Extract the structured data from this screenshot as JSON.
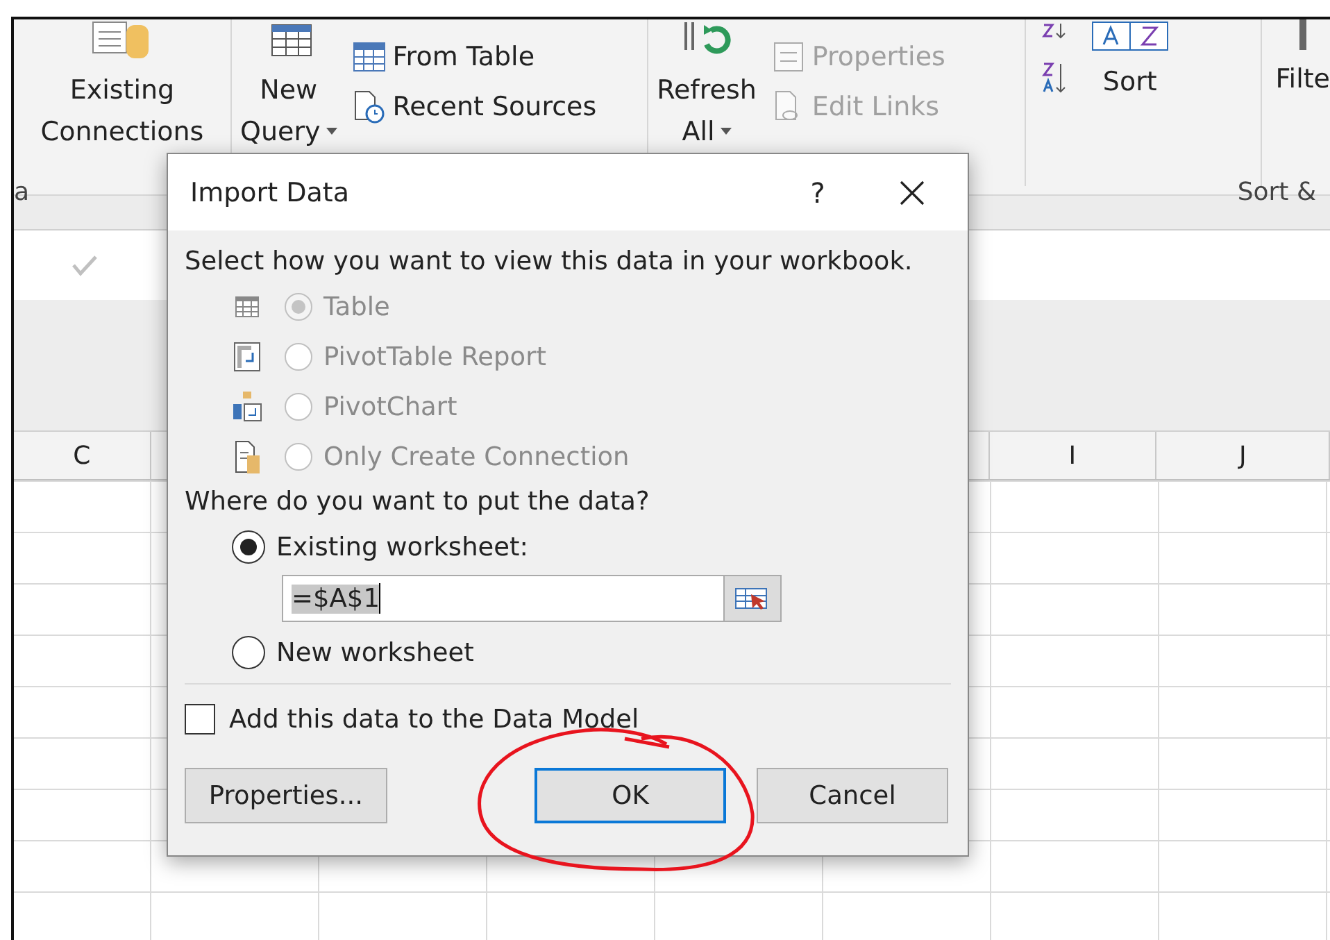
{
  "ribbon": {
    "existing_connections": {
      "label_lines": [
        "Existing",
        "Connections"
      ]
    },
    "new_query": {
      "label_lines": [
        "New",
        "Query"
      ]
    },
    "query_buttons": [
      {
        "label": "From Table",
        "disabled": false
      },
      {
        "label": "Recent Sources",
        "disabled": false
      }
    ],
    "refresh_all": {
      "label_lines": [
        "Refresh",
        "All"
      ]
    },
    "link_buttons": [
      {
        "label": "Properties",
        "disabled": true
      },
      {
        "label": "Edit Links",
        "disabled": true
      }
    ],
    "sort": {
      "label": "Sort"
    },
    "filter": {
      "label": "Filte"
    },
    "group_labels": [
      "a",
      "Sort &"
    ]
  },
  "sheet": {
    "column_headers": [
      "C",
      "I",
      "J"
    ]
  },
  "dialog": {
    "title": "Import Data",
    "help": "?",
    "view_prompt": "Select how you want to view this data in your workbook.",
    "view_options": [
      {
        "kind": "table",
        "label": "Table",
        "selected": true,
        "disabled": true
      },
      {
        "kind": "pivottable",
        "label": "PivotTable Report",
        "selected": false,
        "disabled": true
      },
      {
        "kind": "pivotchart",
        "label": "PivotChart",
        "selected": false,
        "disabled": true
      },
      {
        "kind": "connection",
        "label": "Only Create Connection",
        "selected": false,
        "disabled": true
      }
    ],
    "place_prompt": "Where do you want to put the data?",
    "place_options": [
      {
        "label": "Existing worksheet:",
        "selected": true
      },
      {
        "label": "New worksheet",
        "selected": false
      }
    ],
    "range": {
      "value": "=$A$1"
    },
    "data_model": {
      "label": "Add this data to the Data Model",
      "checked": false
    },
    "buttons": [
      {
        "label": "Properties...",
        "default": false
      },
      {
        "label": "OK",
        "default": true
      },
      {
        "label": "Cancel",
        "default": false
      }
    ]
  }
}
